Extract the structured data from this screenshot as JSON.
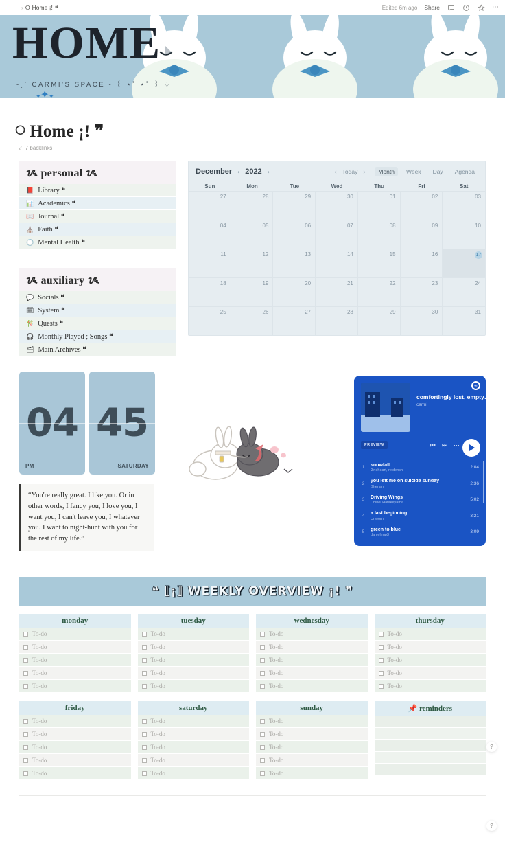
{
  "topbar": {
    "breadcrumb": "Home ¡!",
    "breadcrumb_icon": "⭘",
    "sparkle_icon": "sparkle-icon",
    "edited": "Edited 6m ago",
    "share": "Share",
    "comment_icon": "comment-icon",
    "history_icon": "clock-icon",
    "favorite_icon": "star-icon",
    "more_icon": "⋯"
  },
  "banner": {
    "title": "HOME",
    "subtitle": "-ˏˋ CARMI'S SPACE - ꒰ ⋆˚ ⋆˚ ꒱ ♡",
    "sparkles": "✦✧✦",
    "bg_color": "#a9c9d9"
  },
  "page": {
    "title_emoji": "⭘",
    "title": "Home ¡! ❞",
    "backlinks": "7 backlinks"
  },
  "sections": [
    {
      "heading": "ᝰ personal ᝰ",
      "items": [
        {
          "emoji": "📕",
          "label": "Library ❝"
        },
        {
          "emoji": "📊",
          "label": "Academics ❝"
        },
        {
          "emoji": "📖",
          "label": "Journal ❝"
        },
        {
          "emoji": "⛪",
          "label": "Faith ❝"
        },
        {
          "emoji": "🕛",
          "label": "Mental Health ❝"
        }
      ]
    },
    {
      "heading": "ᝰ auxiliary ᝰ",
      "items": [
        {
          "emoji": "💬",
          "label": "Socials ❝"
        },
        {
          "emoji": "🗓",
          "label": "System ❝"
        },
        {
          "emoji": "🎋",
          "label": "Quests ❝"
        },
        {
          "emoji": "🎧",
          "label": "Monthly Played ; Songs ❝"
        },
        {
          "emoji": "🗂",
          "label": "Main Archives ❝"
        }
      ]
    }
  ],
  "calendar": {
    "month": "December",
    "year": "2022",
    "prev_arrow": "‹",
    "next_arrow": "›",
    "today_label": "Today",
    "views": [
      "Month",
      "Week",
      "Day",
      "Agenda"
    ],
    "active_view": "Month",
    "dow": [
      "Sun",
      "Mon",
      "Tue",
      "Wed",
      "Thu",
      "Fri",
      "Sat"
    ],
    "today_day": "17",
    "days": [
      "27",
      "28",
      "29",
      "30",
      "01",
      "02",
      "03",
      "04",
      "05",
      "06",
      "07",
      "08",
      "09",
      "10",
      "11",
      "12",
      "13",
      "14",
      "15",
      "16",
      "17",
      "18",
      "19",
      "20",
      "21",
      "22",
      "23",
      "24",
      "25",
      "26",
      "27",
      "28",
      "29",
      "30",
      "31"
    ]
  },
  "clock": {
    "hour": "04",
    "minute": "45",
    "meridiem": "PM",
    "weekday": "SATURDAY"
  },
  "quote": {
    "text": "“You're really great. I like you. Or in other words, I fancy you, I love you, I want you, I can't leave you, I whatever you. I want to night-hunt with you for the rest of my life.”"
  },
  "spotify": {
    "playlist_title": "comfortingly lost, empty t...",
    "owner": "carmi",
    "preview_label": "PREVIEW",
    "logo_icon": "spotify-icon",
    "prev_icon": "⏮",
    "next_icon": "⏭",
    "more_icon": "⋯",
    "play_icon": "play-icon",
    "tracks": [
      {
        "index": "1",
        "name": "snowfall",
        "artist": "Øneheart, reidenshi",
        "duration": "2:04"
      },
      {
        "index": "2",
        "name": "you left me on suicide sunday",
        "artist": "Bherian",
        "duration": "2:36"
      },
      {
        "index": "3",
        "name": "Driving Wings",
        "artist": "Chihei Hatakeyama",
        "duration": "5:02"
      },
      {
        "index": "4",
        "name": "a last beginning",
        "artist": "Unworn",
        "duration": "3:21"
      },
      {
        "index": "5",
        "name": "green to blue",
        "artist": "daniel.mp3",
        "duration": "3:09"
      }
    ]
  },
  "weekly": {
    "banner": "❝ ⟦¡⟧ WEEKLY OVERVIEW ¡! ❞",
    "todo_label": "To-do",
    "row_count": 5,
    "columns_row1": [
      {
        "name": "monday"
      },
      {
        "name": "tuesday"
      },
      {
        "name": "wednesday"
      },
      {
        "name": "thursday"
      }
    ],
    "columns_row2": [
      {
        "name": "friday"
      },
      {
        "name": "saturday"
      },
      {
        "name": "sunday"
      }
    ],
    "reminders": {
      "emoji": "📌",
      "name": "reminders",
      "row_count": 5
    }
  },
  "help": {
    "label": "?"
  }
}
